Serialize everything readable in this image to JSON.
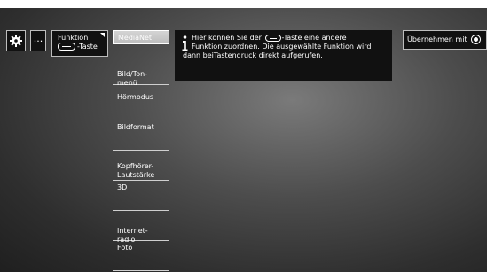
{
  "toolbar": {
    "gear_icon": "gear-icon",
    "more_label": "···",
    "function_button": {
      "line1": "Funktion",
      "line2": "-Taste",
      "key_icon": "key-icon"
    }
  },
  "menu": {
    "items": [
      {
        "label": "MediaNet",
        "selected": true
      },
      {
        "label": "Bild/Ton-\nmenü"
      },
      {
        "label": "Hörmodus"
      },
      {
        "label": "Bildformat"
      },
      {
        "label": "Kopfhörer-\nLautstärke"
      },
      {
        "label": "3D"
      },
      {
        "label": "Internet-\nradio"
      },
      {
        "label": "Foto"
      }
    ]
  },
  "info_panel": {
    "icon": "info-icon",
    "line1_before": "Hier können Sie der ",
    "line1_after": "-Taste eine andere",
    "line2": "Funktion zuordnen. Die ausgewählte Funktion wird",
    "line3": "dann beiTastendruck direkt aufgerufen."
  },
  "accept_button": {
    "label": "Übernehmen mit",
    "icon": "ok-icon"
  },
  "colors": {
    "panel_bg": "#111111",
    "selected_bg": "#cccccc",
    "border": "#bdbdbd",
    "text": "#ffffff"
  }
}
